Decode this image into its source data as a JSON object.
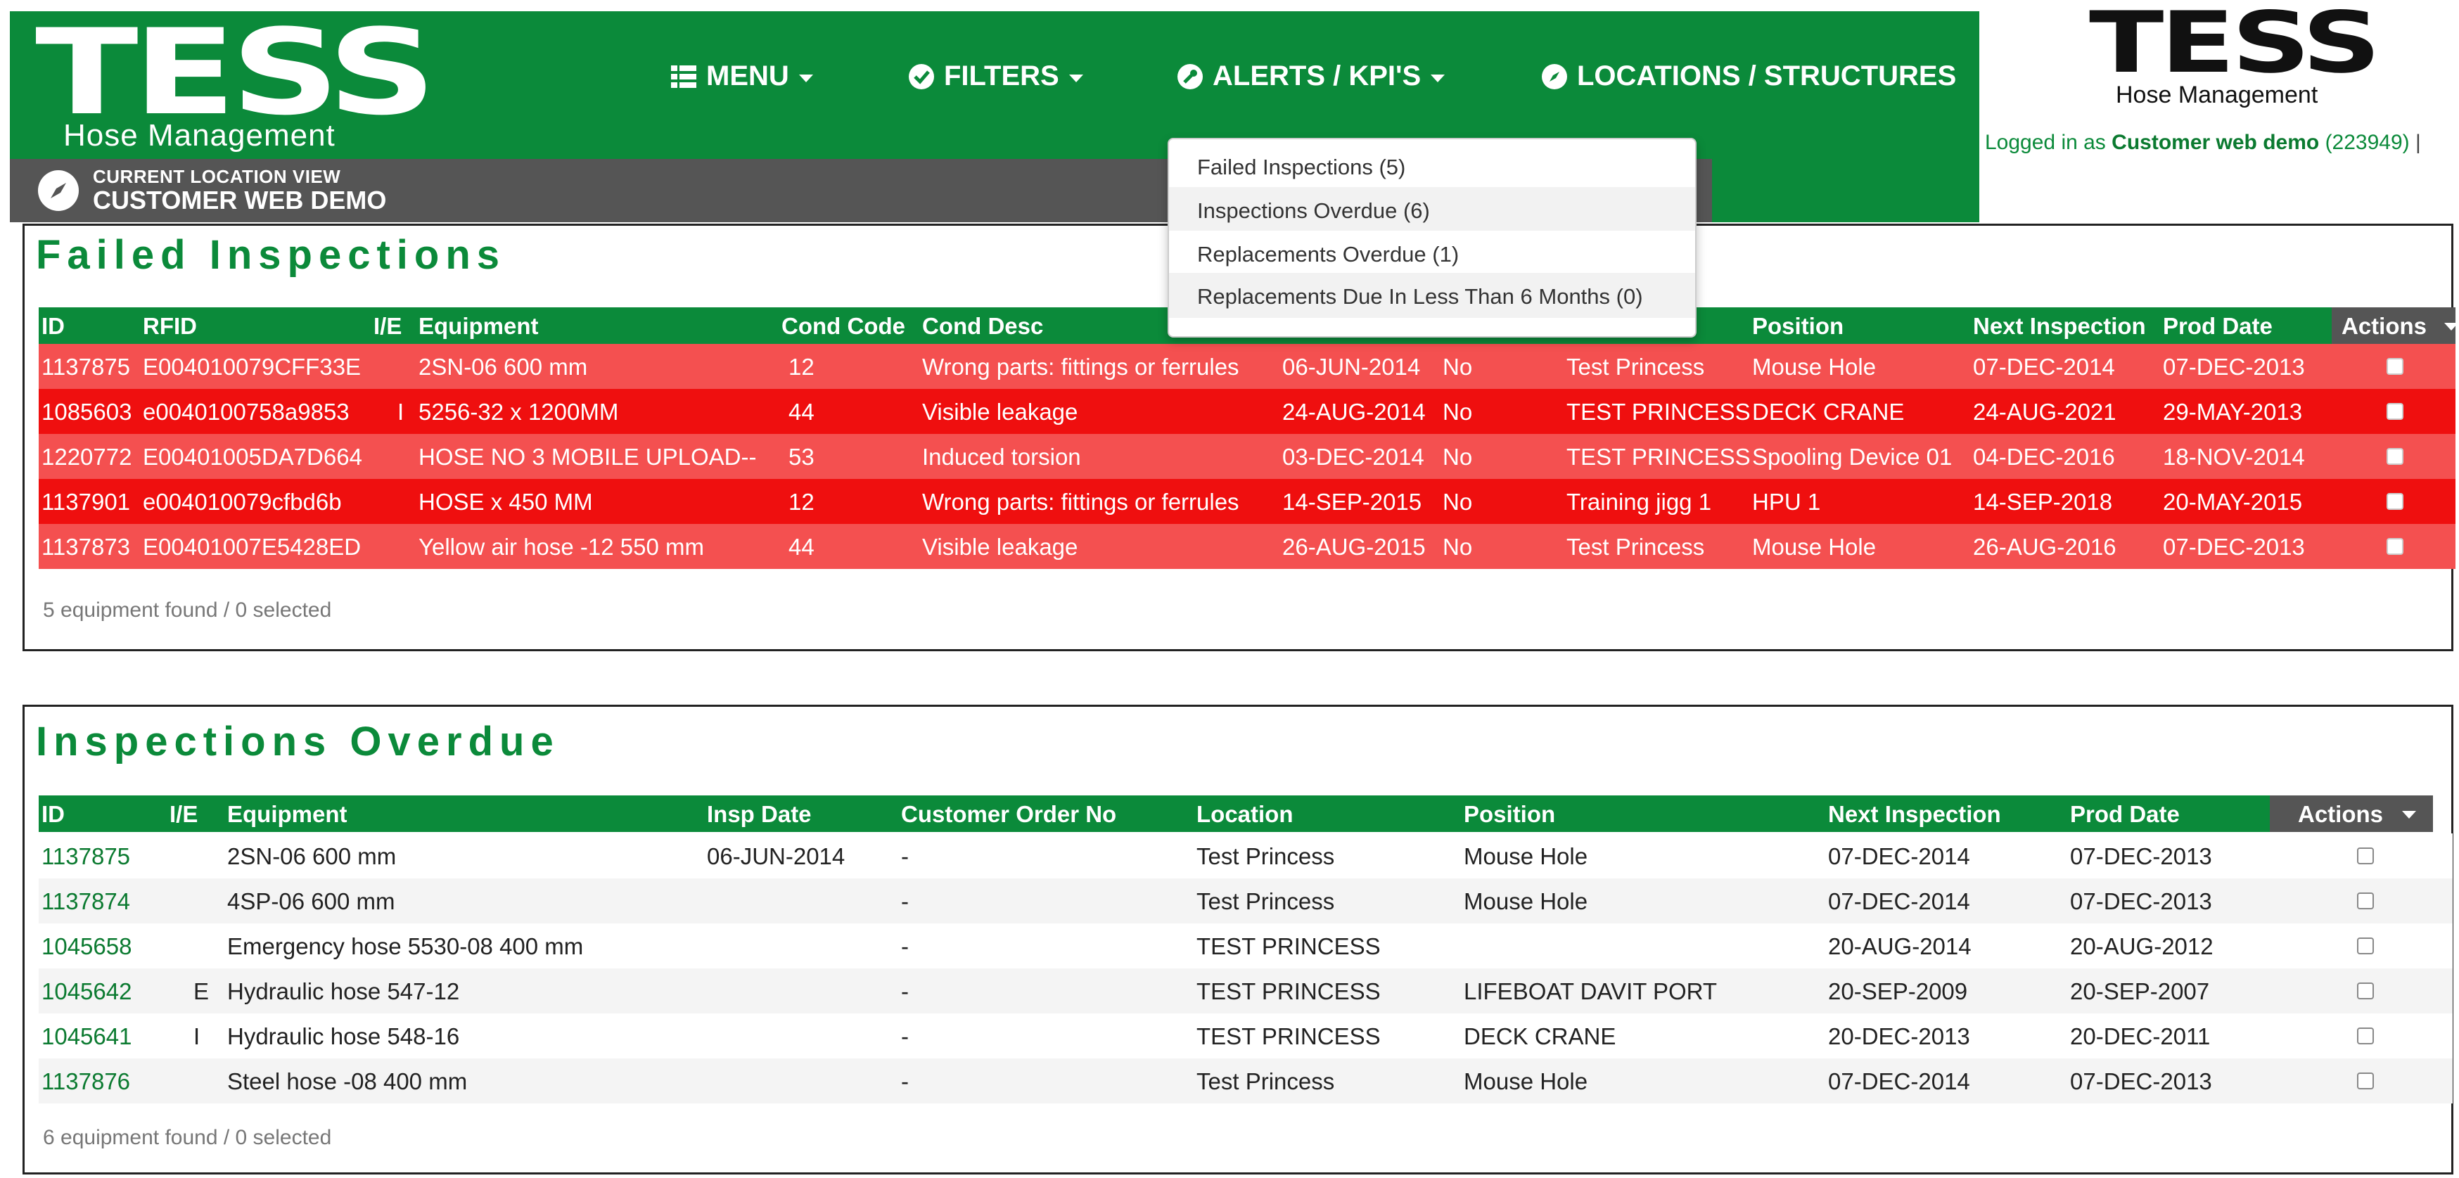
{
  "header": {
    "logo_word": "TESS",
    "logo_sub": "Hose Management",
    "nav": {
      "menu": "MENU",
      "filters": "FILTERS",
      "alerts": "ALERTS / KPI'S",
      "locations": "LOCATIONS / STRUCTURES"
    },
    "location_small": "CURRENT LOCATION VIEW",
    "location_big": "CUSTOMER WEB DEMO",
    "right_logo_word": "TESS",
    "right_logo_sub": "Hose Management",
    "logged_prefix": "Logged in as",
    "logged_user": "Customer web demo",
    "logged_id": "(223949)",
    "logged_pipe": "|"
  },
  "alerts_dropdown": {
    "items": [
      "Failed Inspections (5)",
      "Inspections Overdue (6)",
      "Replacements Overdue (1)",
      "Replacements Due In Less Than 6 Months (0)"
    ]
  },
  "failed": {
    "title": "Failed Inspections",
    "columns": {
      "id": "ID",
      "rfid": "RFID",
      "ie": "I/E",
      "equipment": "Equipment",
      "cond_code": "Cond Code",
      "cond_desc": "Cond Desc",
      "position": "Position",
      "next_inspection": "Next Inspection",
      "prod_date": "Prod Date",
      "actions": "Actions"
    },
    "rows": [
      {
        "id": "1137875",
        "rfid": "E004010079CFF33E",
        "ie": "",
        "equipment": "2SN-06 600 mm",
        "cond_code": "12",
        "cond_desc": "Wrong parts: fittings or ferrules",
        "insp_date": "06-JUN-2014",
        "flag": "No",
        "location": "Test Princess",
        "position": "Mouse Hole",
        "next_inspection": "07-DEC-2014",
        "prod_date": "07-DEC-2013"
      },
      {
        "id": "1085603",
        "rfid": "e0040100758a9853",
        "ie": "I",
        "equipment": "5256-32 x 1200MM",
        "cond_code": "44",
        "cond_desc": "Visible leakage",
        "insp_date": "24-AUG-2014",
        "flag": "No",
        "location": "TEST PRINCESS",
        "position": "DECK CRANE",
        "next_inspection": "24-AUG-2021",
        "prod_date": "29-MAY-2013"
      },
      {
        "id": "1220772",
        "rfid": "E00401005DA7D664",
        "ie": "",
        "equipment": "HOSE NO 3 MOBILE UPLOAD--",
        "cond_code": "53",
        "cond_desc": "Induced torsion",
        "insp_date": "03-DEC-2014",
        "flag": "No",
        "location": "TEST PRINCESS",
        "position": "Spooling Device 01",
        "next_inspection": "04-DEC-2016",
        "prod_date": "18-NOV-2014"
      },
      {
        "id": "1137901",
        "rfid": "e004010079cfbd6b",
        "ie": "",
        "equipment": "HOSE x 450 MM",
        "cond_code": "12",
        "cond_desc": "Wrong parts: fittings or ferrules",
        "insp_date": "14-SEP-2015",
        "flag": "No",
        "location": "Training jigg 1",
        "position": "HPU 1",
        "next_inspection": "14-SEP-2018",
        "prod_date": "20-MAY-2015"
      },
      {
        "id": "1137873",
        "rfid": "E00401007E5428ED",
        "ie": "",
        "equipment": "Yellow air hose -12 550 mm",
        "cond_code": "44",
        "cond_desc": "Visible leakage",
        "insp_date": "26-AUG-2015",
        "flag": "No",
        "location": "Test Princess",
        "position": "Mouse Hole",
        "next_inspection": "26-AUG-2016",
        "prod_date": "07-DEC-2013"
      }
    ],
    "footer": "5 equipment found / 0 selected",
    "colors": {
      "row_light": "#f45050",
      "row_dark": "#ef0f0f",
      "header": "#0b8a3a"
    }
  },
  "overdue": {
    "title": "Inspections Overdue",
    "columns": {
      "id": "ID",
      "ie": "I/E",
      "equipment": "Equipment",
      "insp_date": "Insp Date",
      "order_no": "Customer Order No",
      "location": "Location",
      "position": "Position",
      "next_inspection": "Next Inspection",
      "prod_date": "Prod Date",
      "actions": "Actions"
    },
    "rows": [
      {
        "id": "1137875",
        "ie": "",
        "equipment": "2SN-06 600 mm",
        "insp_date": "06-JUN-2014",
        "order_no": "-",
        "location": "Test Princess",
        "position": "Mouse Hole",
        "next_inspection": "07-DEC-2014",
        "prod_date": "07-DEC-2013"
      },
      {
        "id": "1137874",
        "ie": "",
        "equipment": "4SP-06 600 mm",
        "insp_date": "",
        "order_no": "-",
        "location": "Test Princess",
        "position": "Mouse Hole",
        "next_inspection": "07-DEC-2014",
        "prod_date": "07-DEC-2013"
      },
      {
        "id": "1045658",
        "ie": "",
        "equipment": "Emergency hose 5530-08 400 mm",
        "insp_date": "",
        "order_no": "-",
        "location": "TEST PRINCESS",
        "position": "",
        "next_inspection": "20-AUG-2014",
        "prod_date": "20-AUG-2012"
      },
      {
        "id": "1045642",
        "ie": "E",
        "equipment": "Hydraulic hose 547-12",
        "insp_date": "",
        "order_no": "-",
        "location": "TEST PRINCESS",
        "position": "LIFEBOAT DAVIT PORT",
        "next_inspection": "20-SEP-2009",
        "prod_date": "20-SEP-2007"
      },
      {
        "id": "1045641",
        "ie": "I",
        "equipment": "Hydraulic hose 548-16",
        "insp_date": "",
        "order_no": "-",
        "location": "TEST PRINCESS",
        "position": "DECK CRANE",
        "next_inspection": "20-DEC-2013",
        "prod_date": "20-DEC-2011"
      },
      {
        "id": "1137876",
        "ie": "",
        "equipment": "Steel hose -08 400 mm",
        "insp_date": "",
        "order_no": "-",
        "location": "Test Princess",
        "position": "Mouse Hole",
        "next_inspection": "07-DEC-2014",
        "prod_date": "07-DEC-2013"
      }
    ],
    "footer": "6 equipment found / 0 selected"
  }
}
